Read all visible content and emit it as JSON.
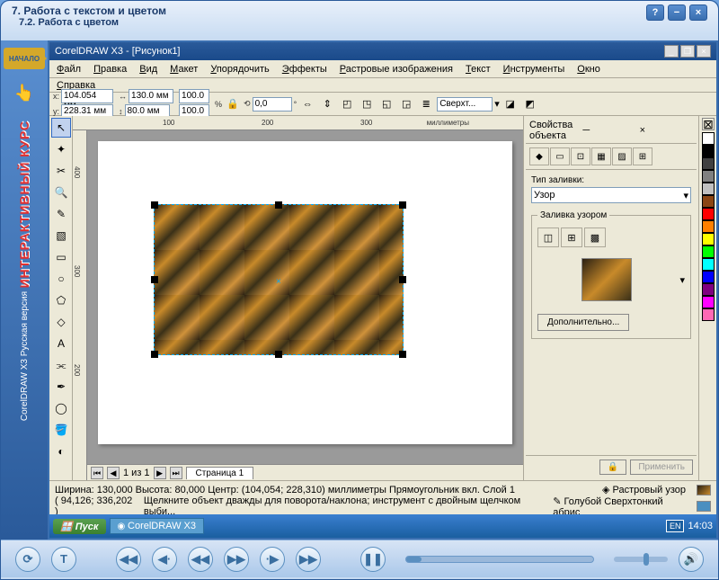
{
  "title": {
    "main": "7. Работа с текстом и цветом",
    "sub": "7.2. Работа с цветом"
  },
  "leftRail": {
    "start": "НАЧАЛО",
    "brand": "ИНТЕРАКТИВНЫЙ КУРС",
    "product": "CorelDRAW X3 Русская версия"
  },
  "app": {
    "title": "CorelDRAW X3 - [Рисунок1]"
  },
  "menu": {
    "file": "Файл",
    "edit": "Правка",
    "view": "Вид",
    "layout": "Макет",
    "arrange": "Упорядочить",
    "effects": "Эффекты",
    "bitmaps": "Растровые изображения",
    "text": "Текст",
    "tools": "Инструменты",
    "window": "Окно",
    "help": "Справка"
  },
  "props": {
    "xlabel": "x:",
    "xval": "104.054 мм",
    "ylabel": "y:",
    "yval": "228.31 мм",
    "wlabel": "↔",
    "wval": "130.0 мм",
    "hlabel": "↕",
    "hval": "80.0 мм",
    "sx": "100.0",
    "sy": "100.0",
    "pct": "%",
    "rotlabel": "⟲",
    "rotval": "0,0",
    "deg": "°",
    "outline": "Сверхт..."
  },
  "ruler": {
    "units": "миллиметры",
    "r100": "100",
    "r200": "200",
    "r300": "300",
    "r400": "400"
  },
  "pageNav": {
    "count": "1 из 1",
    "tab": "Страница 1"
  },
  "docker": {
    "title": "Свойства объекта",
    "fillLabel": "Тип заливки:",
    "fillValue": "Узор",
    "patternGroup": "Заливка узором",
    "advanced": "Дополнительно...",
    "apply": "Применить"
  },
  "status": {
    "line1": "Ширина: 130,000 Высота: 80,000 Центр: (104,054; 228,310) миллиметры    Прямоугольник вкл. Слой 1",
    "fill": "Растровый узор",
    "coords": "( 94,126; 336,202 )",
    "hint": "Щелкните объект дважды для поворота/наклона; инструмент с двойным щелчком выби...",
    "outline": "Голубой Сверхтонкий абрис"
  },
  "taskbar": {
    "start": "Пуск",
    "task": "CorelDRAW X3",
    "lang": "EN",
    "time": "14:03"
  },
  "colors": [
    "#ffffff",
    "#000000",
    "#404040",
    "#808080",
    "#c0c0c0",
    "#8b4513",
    "#ff0000",
    "#ff8000",
    "#ffff00",
    "#00ff00",
    "#00ffff",
    "#0000ff",
    "#800080",
    "#ff00ff",
    "#ff69b4"
  ]
}
